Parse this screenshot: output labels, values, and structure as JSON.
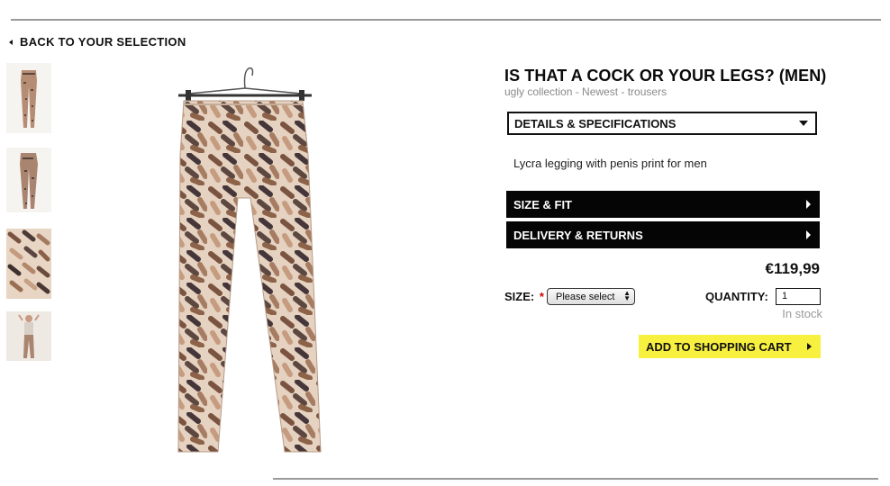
{
  "nav": {
    "back_label": "BACK TO YOUR SELECTION"
  },
  "product": {
    "title": "IS THAT A COCK OR YOUR LEGS? (MEN)",
    "breadcrumb": "ugly collection - Newest - trousers",
    "details_label": "DETAILS & SPECIFICATIONS",
    "description": "Lycra legging with penis print for men",
    "size_fit_label": "SIZE & FIT",
    "delivery_label": "DELIVERY & RETURNS",
    "price": "€119,99"
  },
  "purchase": {
    "size_label": "SIZE:",
    "required_mark": "*",
    "size_selected": "Please select",
    "quantity_label": "QUANTITY:",
    "quantity_value": "1",
    "stock_status": "In stock",
    "add_to_cart_label": "ADD TO SHOPPING CART"
  },
  "colors": {
    "cart_button": "#f7f03e",
    "accordion_bar": "#050505",
    "required": "#cc0000"
  }
}
